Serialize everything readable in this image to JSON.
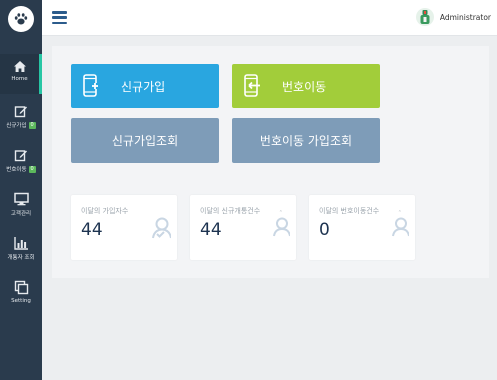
{
  "app": {
    "user_name": "Administrator"
  },
  "sidebar": {
    "items": [
      {
        "label": "Home",
        "icon": "home-icon"
      },
      {
        "label": "신규가입",
        "icon": "edit-icon",
        "badge": "0"
      },
      {
        "label": "번호이동",
        "icon": "edit-icon",
        "badge": "0"
      },
      {
        "label": "고객관리",
        "icon": "monitor-icon"
      },
      {
        "label": "개통자 조회",
        "icon": "bar-chart-icon"
      },
      {
        "label": "Setting",
        "icon": "copy-icon"
      }
    ]
  },
  "actions": {
    "signup": "신규가입",
    "number_port": "번호이동",
    "signup_query": "신규가입조회",
    "number_port_query": "번호이동 가입조회"
  },
  "stats": [
    {
      "title": "이달의 가입자수",
      "value": "44"
    },
    {
      "title": "이달의 신규개통건수",
      "value": "44"
    },
    {
      "title": "이달의 번호이동건수",
      "value": "0"
    }
  ],
  "colors": {
    "sidebar_bg": "#2a3b4d",
    "signup_btn": "#29a6e0",
    "port_btn": "#a2cd3a",
    "query_btn": "#7e9cb8",
    "active_accent": "#27c6a4"
  }
}
